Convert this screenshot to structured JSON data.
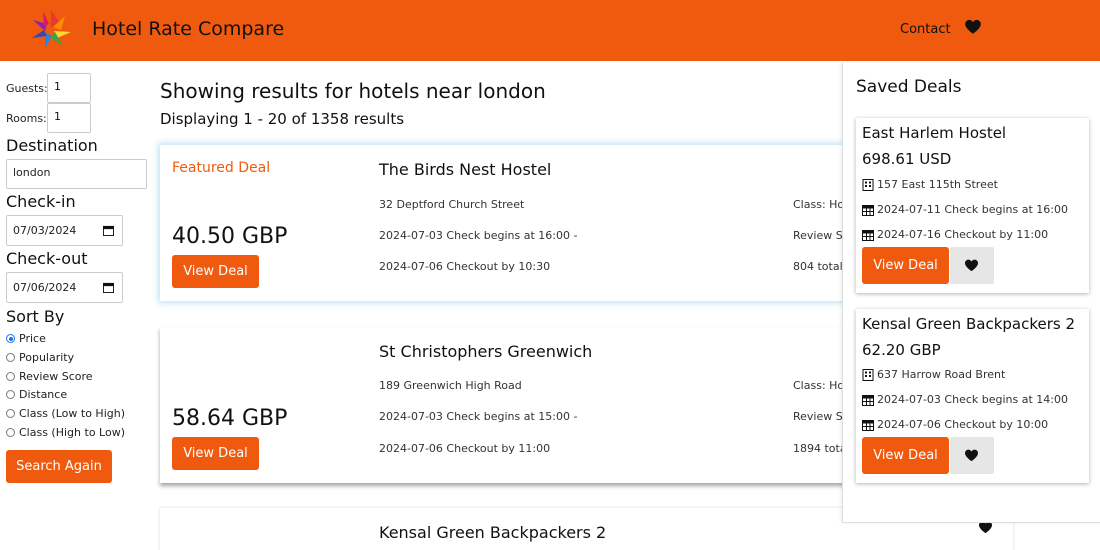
{
  "header": {
    "title": "Hotel Rate Compare",
    "nav_contact": "Contact",
    "brand_color": "#f05a0f"
  },
  "sidebar": {
    "guests_label": "Guests:",
    "guests_value": "1",
    "rooms_label": "Rooms:",
    "rooms_value": "1",
    "destination_label": "Destination",
    "destination_value": "london",
    "checkin_label": "Check-in",
    "checkin_value": "07/03/2024",
    "checkout_label": "Check-out",
    "checkout_value": "07/06/2024",
    "sort_label": "Sort By",
    "sort_options": [
      "Price",
      "Popularity",
      "Review Score",
      "Distance",
      "Class (Low to High)",
      "Class (High to Low)"
    ],
    "sort_selected": "Price",
    "search_button": "Search Again"
  },
  "main": {
    "title": "Showing results for hotels near london",
    "count": "Displaying 1 - 20 of 1358 results",
    "results": [
      {
        "featured": "Featured Deal",
        "price": "40.50 GBP",
        "button": "View Deal",
        "name": "The Birds Nest Hostel",
        "address": "32 Deptford Church Street",
        "checkin": "2024-07-03 Check begins at 16:00 -",
        "checkout": "2024-07-06 Checkout by 10:30",
        "class": "Class: Hot",
        "review": "Review Sc",
        "total": "804 total"
      },
      {
        "price": "58.64 GBP",
        "button": "View Deal",
        "name": "St Christophers Greenwich",
        "address": "189 Greenwich High Road",
        "checkin": "2024-07-03 Check begins at 15:00 -",
        "checkout": "2024-07-06 Checkout by 11:00",
        "class": "Class: Hot",
        "review": "Review Sc",
        "total": "1894 tota"
      },
      {
        "name": "Kensal Green Backpackers 2"
      }
    ]
  },
  "saved": {
    "title": "Saved Deals",
    "deals": [
      {
        "name": "East Harlem Hostel",
        "price": "698.61 USD",
        "address": "157 East 115th Street",
        "checkin": "2024-07-11 Check begins at 16:00",
        "checkout": "2024-07-16 Checkout by 11:00",
        "button": "View Deal"
      },
      {
        "name": "Kensal Green Backpackers 2",
        "price": "62.20 GBP",
        "address": "637 Harrow Road Brent",
        "checkin": "2024-07-03 Check begins at 14:00",
        "checkout": "2024-07-06 Checkout by 10:00",
        "button": "View Deal"
      }
    ]
  }
}
